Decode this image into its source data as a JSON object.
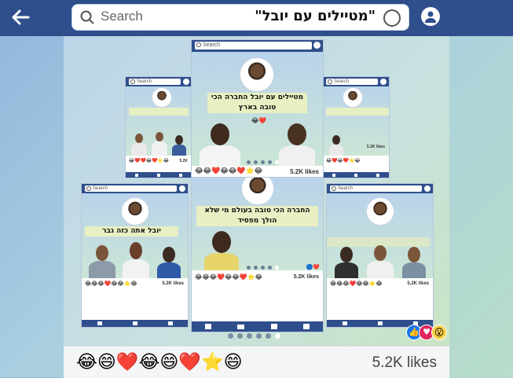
{
  "header": {
    "back_icon": "arrow-left-icon",
    "search_placeholder": "Search",
    "search_value": "\"מטיילים עם יובל\"",
    "profile_icon": "user-circle-icon"
  },
  "cards": {
    "main_top": {
      "search": "Search",
      "caption": "מטיילים עם יובל החברה הכי טובה בארץ",
      "emojis": "😂😂❤️😂😂❤️⭐😂",
      "likes": "5.2K likes"
    },
    "left_small": {
      "search": "Search",
      "emojis": "😂❤️❤️😂❤️⭐😂",
      "likes": "5.2K"
    },
    "right_small": {
      "search": "Search",
      "emojis": "😂❤️😂❤️⭐😂",
      "likes": "5.2K likes"
    },
    "left_mid": {
      "search": "Search",
      "caption": "יובל אתה כזה גבר",
      "emojis": "😂😂😂❤️😂😂⭐😂",
      "likes": "5.2K likes"
    },
    "center_mid": {
      "caption": "החברה הכי טובה בעולם מי שלא הולך מפסיד",
      "emojis": "😂😂😂❤️😂😂❤️⭐😂",
      "likes": "5.2K likes"
    },
    "right_mid": {
      "search": "Search",
      "emojis": "😂😂😂❤️😂😂⭐😂",
      "likes": "5.2K likes"
    }
  },
  "footer": {
    "emojis": "😂😄❤️😂😄❤️⭐😄",
    "likes": "5.2K likes"
  },
  "colors": {
    "topbar": "#2f4f8c",
    "like_blue": "#1877f2",
    "love_red": "#e0245e"
  }
}
